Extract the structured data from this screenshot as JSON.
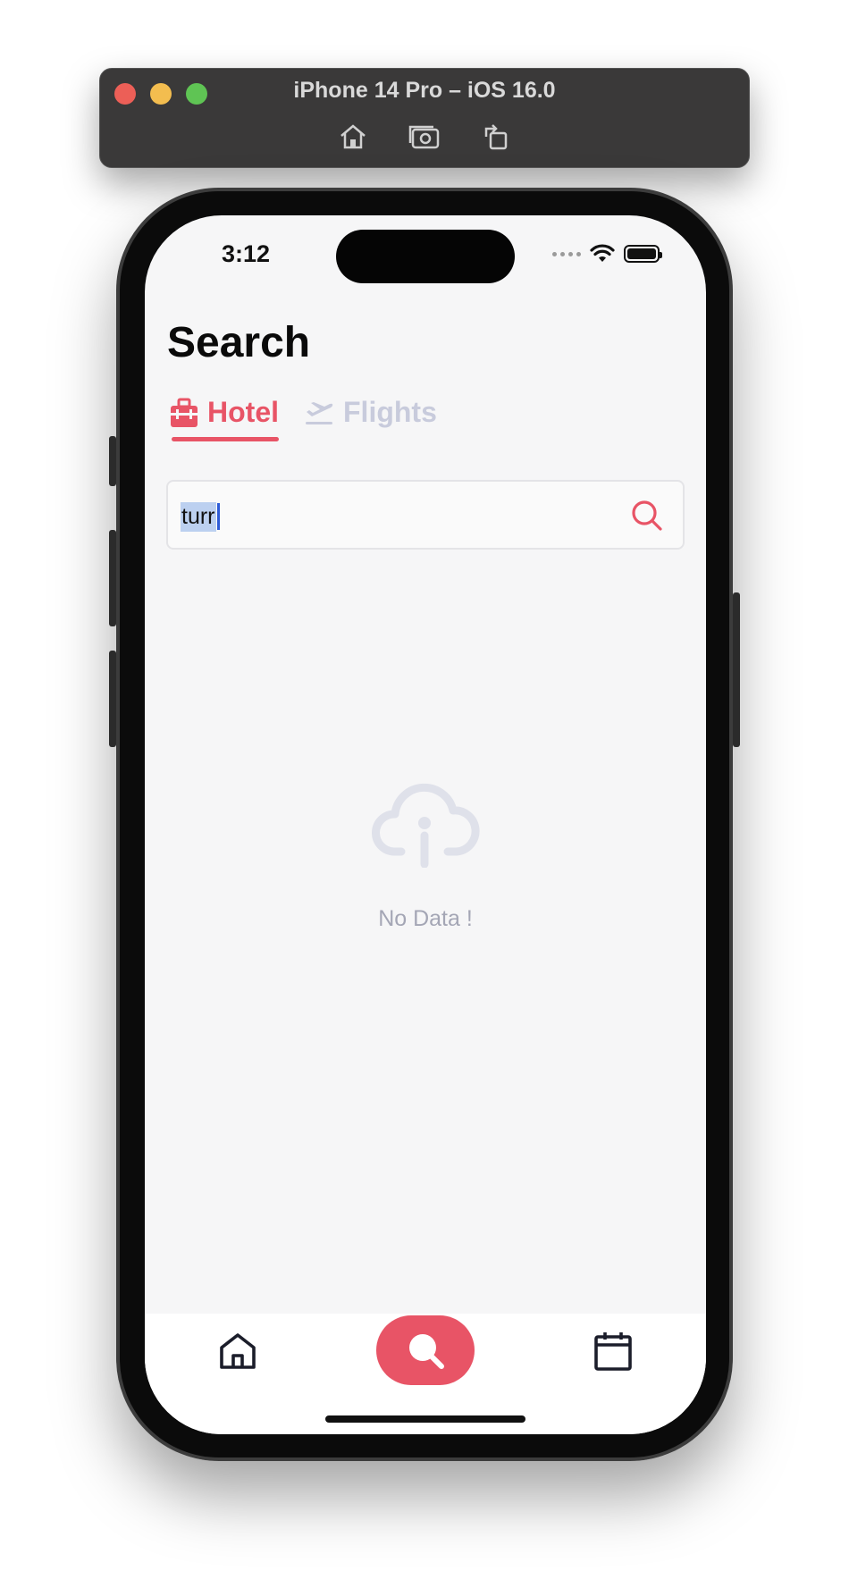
{
  "simulator": {
    "title": "iPhone 14 Pro – iOS 16.0",
    "tools": [
      "home-icon",
      "screenshot-icon",
      "rotate-icon"
    ]
  },
  "status_bar": {
    "time": "3:12"
  },
  "page": {
    "title": "Search"
  },
  "tabs": [
    {
      "label": "Hotel",
      "icon": "hotel-icon",
      "active": true
    },
    {
      "label": "Flights",
      "icon": "flight-departure-icon",
      "active": false
    }
  ],
  "search": {
    "value": "turr",
    "icon": "search-icon"
  },
  "empty_state": {
    "icon": "cloud-info-icon",
    "message": "No Data !"
  },
  "bottom_nav": {
    "items": [
      {
        "icon": "home-icon",
        "active": false
      },
      {
        "icon": "search-icon",
        "active": true
      },
      {
        "icon": "calendar-icon",
        "active": false
      }
    ]
  },
  "colors": {
    "accent": "#e85466",
    "inactive_tab": "#c8cbdc",
    "screen_bg": "#f6f6f7",
    "empty_icon": "#dfe1ea"
  }
}
